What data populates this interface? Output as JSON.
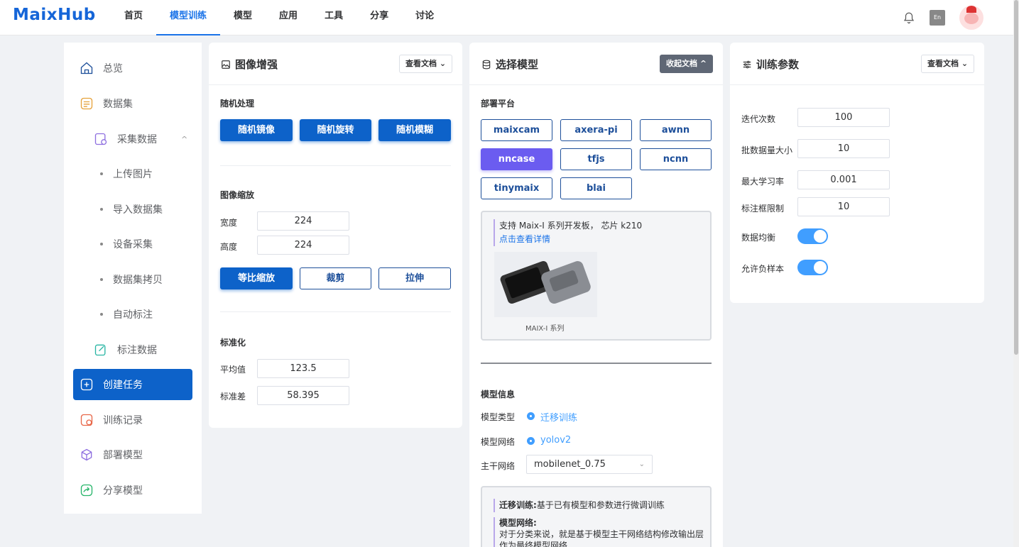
{
  "logo": "MaixHub",
  "nav": [
    "首页",
    "模型训练",
    "模型",
    "应用",
    "工具",
    "分享",
    "讨论"
  ],
  "nav_active": 1,
  "colors": {
    "brand": "#1565d8",
    "accent": "#0d62c9",
    "selected_platform": "#6b5cf0",
    "toggle": "#409eff"
  },
  "sidebar": {
    "overview": "总览",
    "dataset": "数据集",
    "collect": "采集数据",
    "sub_items": [
      "上传图片",
      "导入数据集",
      "设备采集",
      "数据集拷贝",
      "自动标注"
    ],
    "annotate": "标注数据",
    "create_task": "创建任务",
    "train_records": "训练记录",
    "deploy": "部署模型",
    "share": "分享模型"
  },
  "aug": {
    "title": "图像增强",
    "doc_btn": "查看文档",
    "random_label": "随机处理",
    "random_buttons": [
      "随机镜像",
      "随机旋转",
      "随机模糊"
    ],
    "scale_label": "图像缩放",
    "width_label": "宽度",
    "width_value": "224",
    "height_label": "高度",
    "height_value": "224",
    "scale_buttons": [
      "等比缩放",
      "裁剪",
      "拉伸"
    ],
    "norm_label": "标准化",
    "mean_label": "平均值",
    "mean_value": "123.5",
    "std_label": "标准差",
    "std_value": "58.395"
  },
  "model": {
    "title": "选择模型",
    "collapse_btn": "收起文档",
    "platform_label": "部署平台",
    "platforms": [
      "maixcam",
      "axera-pi",
      "awnn",
      "nncase",
      "tfjs",
      "ncnn",
      "tinymaix",
      "blai"
    ],
    "platform_selected": "nncase",
    "info_line1": "支持 Maix-I 系列开发板， 芯片 k210",
    "info_link": "点击查看详情",
    "device_caption": "MAIX-I 系列",
    "model_info_label": "模型信息",
    "type_label": "模型类型",
    "type_value": "迁移训练",
    "network_label": "模型网络",
    "network_value": "yolov2",
    "backbone_label": "主干网络",
    "backbone_value": "mobilenet_0.75",
    "desc1_title": "迁移训练:",
    "desc1_text": "基于已有模型和参数进行微调训练",
    "desc2_title": "模型网络:",
    "desc2_text": "对于分类来说，就是基于模型主干网络结构修改输出层",
    "desc2_text2": "作为最终模型网络"
  },
  "params": {
    "title": "训练参数",
    "doc_btn": "查看文档",
    "iter_label": "迭代次数",
    "iter_value": "100",
    "batch_label": "批数据量大小",
    "batch_value": "10",
    "lr_label": "最大学习率",
    "lr_value": "0.001",
    "box_label": "标注框限制",
    "box_value": "10",
    "balance_label": "数据均衡",
    "balance_on": true,
    "negative_label": "允许负样本",
    "negative_on": true
  }
}
